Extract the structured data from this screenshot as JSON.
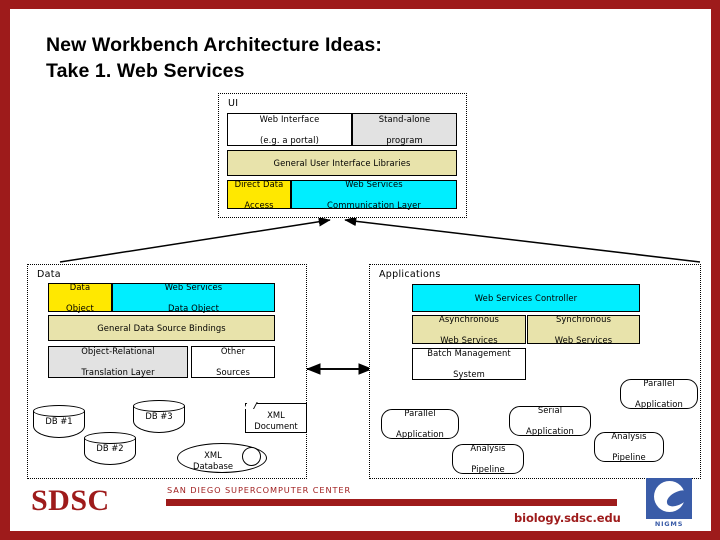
{
  "slide": {
    "title_line1": "New Workbench Architecture Ideas:",
    "title_line2": "Take 1. Web Services",
    "frame_color": "#9e1b1b",
    "background": "#ffffff"
  },
  "diagram": {
    "groups": [
      {
        "id": "ui",
        "label": "UI"
      },
      {
        "id": "data",
        "label": "Data"
      },
      {
        "id": "applications",
        "label": "Applications"
      }
    ],
    "ui_group": {
      "label": "UI",
      "nodes": [
        {
          "name": "web-interface",
          "lines": [
            "Web Interface",
            "(e.g. a portal)"
          ],
          "color": "#ffffff"
        },
        {
          "name": "stand-alone-program",
          "lines": [
            "Stand-alone",
            "program"
          ],
          "color": "#e2e2e2"
        },
        {
          "name": "general-user-interface-libraries",
          "lines": [
            "General User Interface Libraries"
          ],
          "color": "#e8e3ab"
        },
        {
          "name": "direct-data-access",
          "lines": [
            "Direct Data",
            "Access"
          ],
          "color": "#ffe800"
        },
        {
          "name": "web-services-communication-layer",
          "lines": [
            "Web Services",
            "Communication Layer"
          ],
          "color": "#00eeff"
        }
      ]
    },
    "data_group": {
      "label": "Data",
      "nodes": [
        {
          "name": "data-object",
          "lines": [
            "Data",
            "Object"
          ],
          "color": "#ffe800"
        },
        {
          "name": "web-services-data-object",
          "lines": [
            "Web Services",
            "Data Object"
          ],
          "color": "#00eeff"
        },
        {
          "name": "general-data-source-bindings",
          "lines": [
            "General Data Source Bindings"
          ],
          "color": "#e8e3ab"
        },
        {
          "name": "object-relational-translation-layer",
          "lines": [
            "Object-Relational",
            "Translation Layer"
          ],
          "color": "#e2e2e2"
        },
        {
          "name": "other-sources",
          "lines": [
            "Other",
            "Sources"
          ],
          "color": "#ffffff"
        }
      ],
      "databases": [
        {
          "name": "db-1",
          "label": "DB #1"
        },
        {
          "name": "db-2",
          "label": "DB #2"
        },
        {
          "name": "db-3",
          "label": "DB #3"
        }
      ],
      "xml_document": {
        "lines": [
          "XML",
          "Document"
        ]
      },
      "xml_database": {
        "lines": [
          "XML",
          "Database"
        ]
      }
    },
    "applications_group": {
      "label": "Applications",
      "nodes": [
        {
          "name": "web-services-controller",
          "lines": [
            "Web Services Controller"
          ],
          "color": "#00eeff"
        },
        {
          "name": "asynchronous-web-services",
          "lines": [
            "Asynchronous",
            "Web Services"
          ],
          "color": "#e8e3ab"
        },
        {
          "name": "synchronous-web-services",
          "lines": [
            "Synchronous",
            "Web Services"
          ],
          "color": "#e8e3ab"
        },
        {
          "name": "batch-management-system",
          "lines": [
            "Batch Management",
            "System"
          ],
          "color": "#ffffff"
        }
      ],
      "leaves": [
        {
          "name": "parallel-application-left",
          "lines": [
            "Parallel",
            "Application"
          ]
        },
        {
          "name": "analysis-pipeline-left",
          "lines": [
            "Analysis",
            "Pipeline"
          ]
        },
        {
          "name": "serial-application",
          "lines": [
            "Serial",
            "Application"
          ]
        },
        {
          "name": "analysis-pipeline-right",
          "lines": [
            "Analysis",
            "Pipeline"
          ]
        },
        {
          "name": "parallel-application-right",
          "lines": [
            "Parallel",
            "Application"
          ]
        }
      ]
    }
  },
  "footer": {
    "logo": "SDSC",
    "center_name": "SAN DIEGO SUPERCOMPUTER CENTER",
    "url": "biology.sdsc.edu",
    "nigms_label": "NIGMS",
    "brand_color": "#9e1b1b",
    "nigms_color": "#3a5ca8"
  }
}
